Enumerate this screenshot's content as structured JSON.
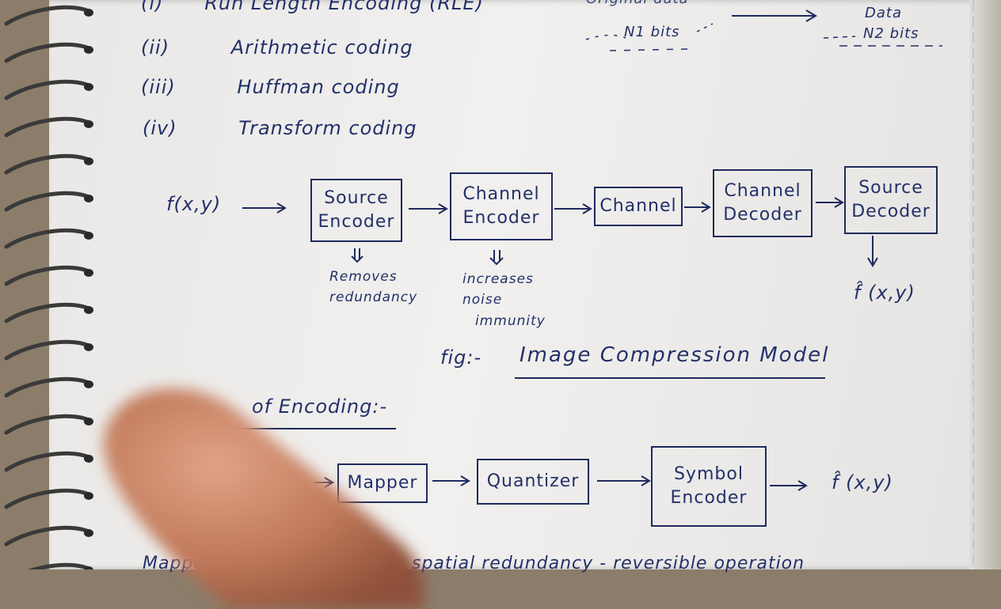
{
  "list": {
    "items": [
      {
        "num": "(i)",
        "text": "Run Length Encoding (RLE)"
      },
      {
        "num": "(ii)",
        "text": "Arithmetic coding"
      },
      {
        "num": "(iii)",
        "text": "Huffman coding"
      },
      {
        "num": "(iv)",
        "text": "Transform coding"
      }
    ]
  },
  "top_right": {
    "original_label": "Original data",
    "n1": "N1 bits",
    "data_label": "Data",
    "n2": "N2 bits"
  },
  "model": {
    "input": "f(x,y)",
    "boxes": [
      {
        "line1": "Source",
        "line2": "Encoder"
      },
      {
        "line1": "Channel",
        "line2": "Encoder"
      },
      {
        "line1": "Channel",
        "line2": ""
      },
      {
        "line1": "Channel",
        "line2": "Decoder"
      },
      {
        "line1": "Source",
        "line2": "Decoder"
      }
    ],
    "source_note": [
      "Removes",
      "redundancy"
    ],
    "channel_note": [
      "increases",
      "noise",
      "immunity"
    ],
    "output": "f̂ (x,y)",
    "caption_prefix": "fig:-",
    "caption": "Image Compression Model"
  },
  "encoding": {
    "heading": "of Encoding:-",
    "boxes": [
      "Mapper",
      "Quantizer",
      "Symbol Encoder"
    ],
    "symbol_line1": "Symbol",
    "symbol_line2": "Encoder",
    "output": "f̂ (x,y)"
  },
  "bottom_partial": {
    "left": "Mapper",
    "right": "spatial redundancy - reversible operation"
  },
  "colors": {
    "ink": "#23306a",
    "paper": "#efeeec",
    "background": "#8b7d6a"
  }
}
